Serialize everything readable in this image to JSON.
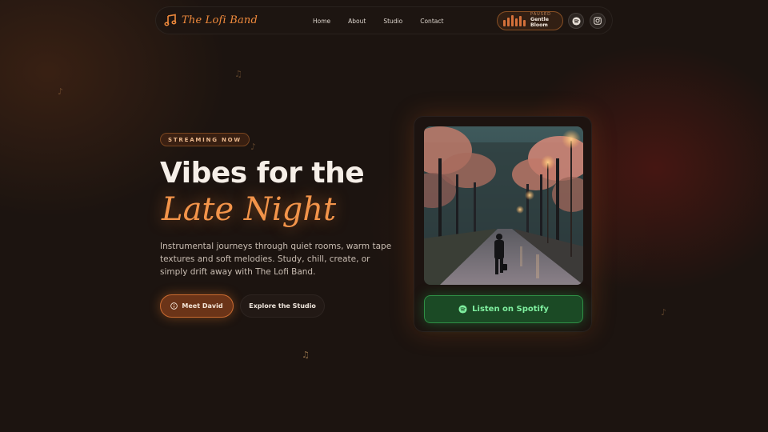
{
  "brand": {
    "name": "The Lofi Band",
    "icon": "music-note-icon"
  },
  "nav": {
    "links": [
      "Home",
      "About",
      "Studio",
      "Contact"
    ]
  },
  "player": {
    "status": "PAUSED",
    "track": "Gentle Bloom",
    "equalizer_levels": [
      0.55,
      0.8,
      1.0,
      0.7,
      0.9,
      0.6
    ]
  },
  "social": {
    "spotify_icon": "spotify-icon",
    "instagram_icon": "instagram-icon"
  },
  "hero": {
    "badge": "STREAMING NOW",
    "headline": "Vibes for the",
    "headline_accent": "Late Night",
    "description": "Instrumental journeys through quiet rooms, warm tape textures and soft melodies. Study, chill, create, or simply drift away with The Lofi Band.",
    "primary_button": "Meet David",
    "secondary_button": "Explore the Studio"
  },
  "card": {
    "button": "Listen on Spotify"
  },
  "colors": {
    "accent": "#f08a3c",
    "spotify": "#2f8f45",
    "background": "#1c1410"
  }
}
